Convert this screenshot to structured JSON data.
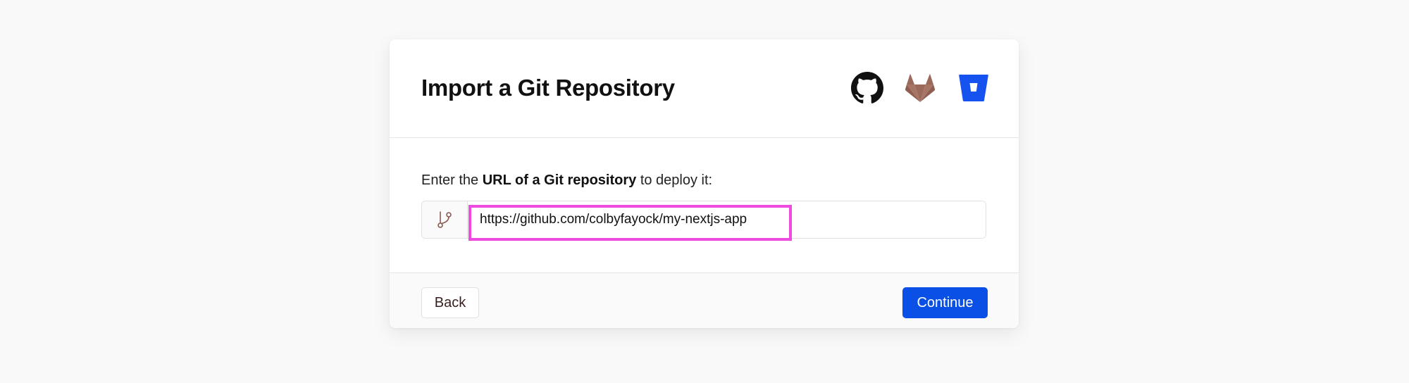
{
  "dialog": {
    "title": "Import a Git Repository",
    "providers": [
      {
        "name": "GitHub",
        "icon": "github-icon"
      },
      {
        "name": "GitLab",
        "icon": "gitlab-icon"
      },
      {
        "name": "Bitbucket",
        "icon": "bitbucket-icon"
      }
    ]
  },
  "form": {
    "prompt_prefix": "Enter the ",
    "prompt_bold": "URL of a Git repository",
    "prompt_suffix": " to deploy it:",
    "prefix_icon": "git-branch-icon",
    "url_value": "https://github.com/colbyfayock/my-nextjs-app"
  },
  "footer": {
    "back_label": "Back",
    "continue_label": "Continue"
  },
  "colors": {
    "highlight": "#ee4be0",
    "primary": "#0b50e6",
    "gitlab": "#9b6a5b",
    "bitbucket": "#1652f0"
  }
}
